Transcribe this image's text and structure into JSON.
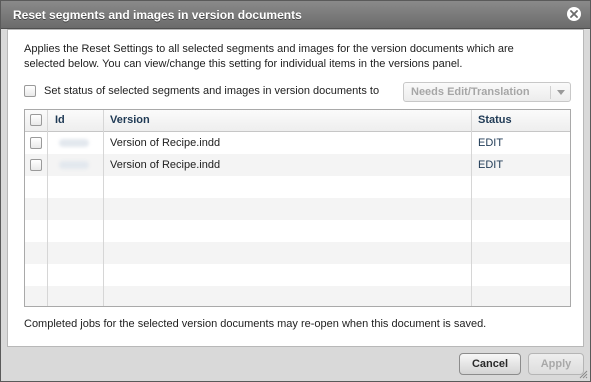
{
  "dialog": {
    "title": "Reset segments and images in version documents",
    "description": "Applies the Reset Settings to all selected segments and images for the version documents which are selected below. You can view/change this setting for individual items in the versions panel.",
    "status_checkbox_label": "Set status of selected segments and images in version documents to",
    "status_select_value": "Needs Edit/Translation",
    "footer_note": "Completed jobs for the selected version documents may re-open when this document is saved.",
    "cancel_label": "Cancel",
    "apply_label": "Apply"
  },
  "grid": {
    "columns": {
      "id": "Id",
      "version": "Version",
      "status": "Status"
    },
    "rows": [
      {
        "version": "Version of Recipe.indd",
        "status": "EDIT"
      },
      {
        "version": "Version of Recipe.indd",
        "status": "EDIT"
      }
    ]
  },
  "icons": {
    "close": "close-icon",
    "dropdown": "chevron-down-icon",
    "resize": "resize-grip-icon"
  },
  "colors": {
    "titlebar": "#7a7a7a",
    "header_text": "#1f3a55",
    "disabled_text": "#a8a8a8"
  }
}
